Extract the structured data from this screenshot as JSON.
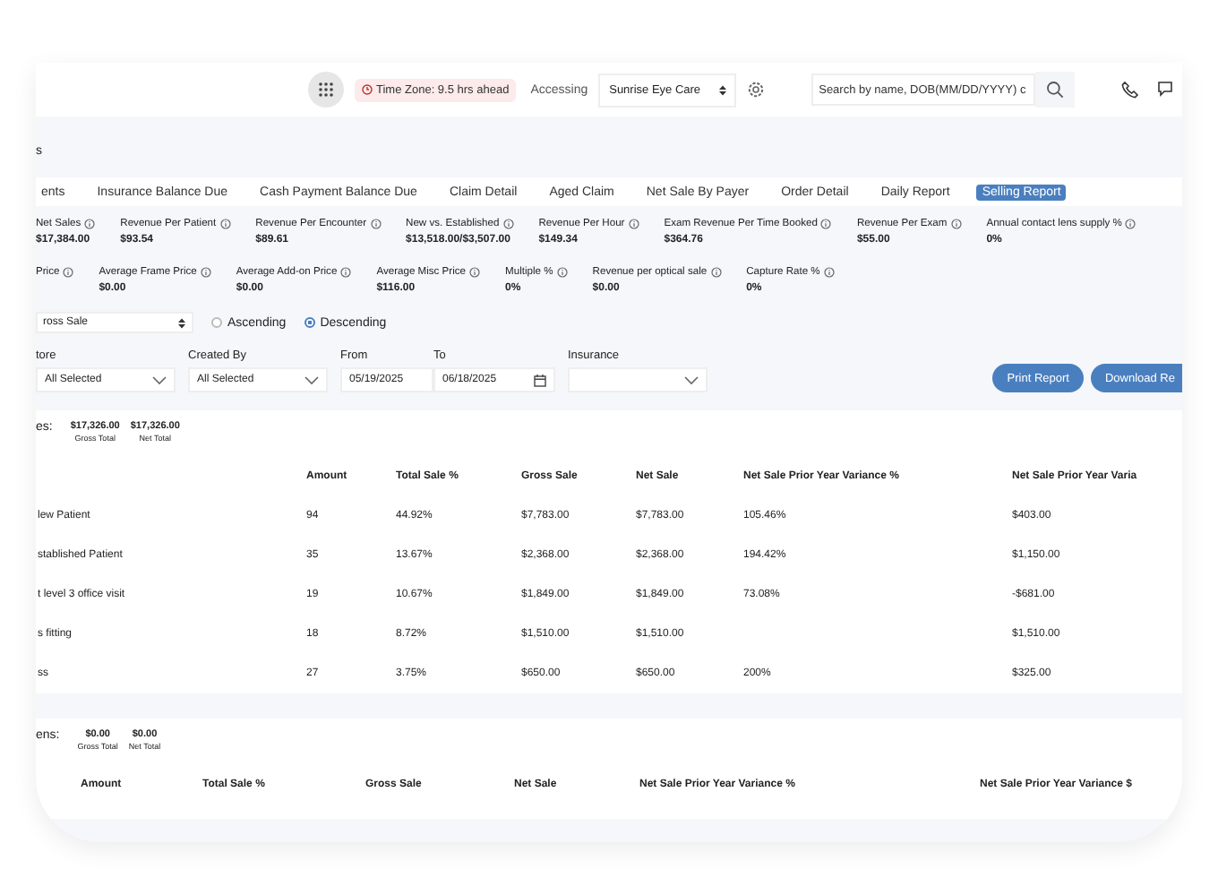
{
  "header": {
    "timezone": "Time Zone: 9.5 hrs ahead",
    "accessing_label": "Accessing",
    "location": "Sunrise Eye Care",
    "search": {
      "placeholder": "Search by name, DOB(MM/DD/YYYY) c"
    }
  },
  "page_title": "s",
  "tabs": [
    {
      "label": "ents",
      "selected": false
    },
    {
      "label": "Insurance Balance Due",
      "selected": false
    },
    {
      "label": "Cash Payment Balance Due",
      "selected": false
    },
    {
      "label": "Claim Detail",
      "selected": false
    },
    {
      "label": "Aged Claim",
      "selected": false
    },
    {
      "label": "Net Sale By Payer",
      "selected": false
    },
    {
      "label": "Order Detail",
      "selected": false
    },
    {
      "label": "Daily Report",
      "selected": false
    },
    {
      "label": "Selling Report",
      "selected": true
    }
  ],
  "metrics": [
    [
      {
        "label": "Net Sales",
        "value": "$17,384.00"
      },
      {
        "label": "Revenue Per Patient",
        "value": "$93.54"
      },
      {
        "label": "Revenue Per Encounter",
        "value": "$89.61"
      },
      {
        "label": "New vs. Established",
        "value": "$13,518.00/$3,507.00"
      },
      {
        "label": "Revenue Per Hour",
        "value": "$149.34"
      },
      {
        "label": "Exam Revenue Per Time Booked",
        "value": "$364.76"
      },
      {
        "label": "Revenue Per Exam",
        "value": "$55.00"
      },
      {
        "label": "Annual contact lens supply %",
        "value": "0%"
      }
    ],
    [
      {
        "label": "Price"
      },
      {
        "label": "Average Frame Price",
        "value": "$0.00"
      },
      {
        "label": "Average Add-on Price",
        "value": "$0.00"
      },
      {
        "label": "Average Misc Price",
        "value": "$116.00"
      },
      {
        "label": "Multiple %",
        "value": "0%"
      },
      {
        "label": "Revenue per optical sale",
        "value": "$0.00"
      },
      {
        "label": "Capture Rate %",
        "value": "0%"
      }
    ]
  ],
  "sort": {
    "field": "ross Sale",
    "options": [
      {
        "label": "Ascending",
        "selected": false
      },
      {
        "label": "Descending",
        "selected": true
      }
    ]
  },
  "filters": [
    {
      "label": "tore",
      "value": "All Selected",
      "kind": "select"
    },
    {
      "label": "Created By",
      "value": "All Selected",
      "kind": "select"
    },
    {
      "label": "From",
      "value": "05/19/2025",
      "kind": "date"
    },
    {
      "label": "To",
      "value": "06/18/2025",
      "kind": "calendar"
    },
    {
      "label": "Insurance",
      "kind": "select"
    }
  ],
  "buttons": [
    "Print Report",
    "Download Re"
  ],
  "sections": [
    {
      "title": "es:",
      "totals": [
        {
          "value": "$17,326.00",
          "label": "Gross Total"
        },
        {
          "value": "$17,326.00",
          "label": "Net Total"
        }
      ],
      "columns": [
        "",
        "Amount",
        "Total Sale %",
        "Gross Sale",
        "Net Sale",
        "Net Sale Prior Year Variance %",
        "Net Sale Prior Year Varia"
      ],
      "rows": [
        [
          "lew Patient",
          "94",
          "44.92%",
          "$7,783.00",
          "$7,783.00",
          "105.46%",
          "$403.00"
        ],
        [
          "stablished Patient",
          "35",
          "13.67%",
          "$2,368.00",
          "$2,368.00",
          "194.42%",
          "$1,150.00"
        ],
        [
          "t level 3 office visit",
          "19",
          "10.67%",
          "$1,849.00",
          "$1,849.00",
          "73.08%",
          "-$681.00"
        ],
        [
          "s fitting",
          "18",
          "8.72%",
          "$1,510.00",
          "$1,510.00",
          "",
          "$1,510.00"
        ],
        [
          "ss",
          "27",
          "3.75%",
          "$650.00",
          "$650.00",
          "200%",
          "$325.00"
        ]
      ]
    },
    {
      "title": "ens:",
      "totals": [
        {
          "value": "$0.00",
          "label": "Gross Total"
        },
        {
          "value": "$0.00",
          "label": "Net Total"
        }
      ],
      "columns": [
        "",
        "Amount",
        "Total Sale %",
        "Gross Sale",
        "Net Sale",
        "Net Sale Prior Year Variance %",
        "Net Sale Prior Year Variance $"
      ]
    }
  ]
}
